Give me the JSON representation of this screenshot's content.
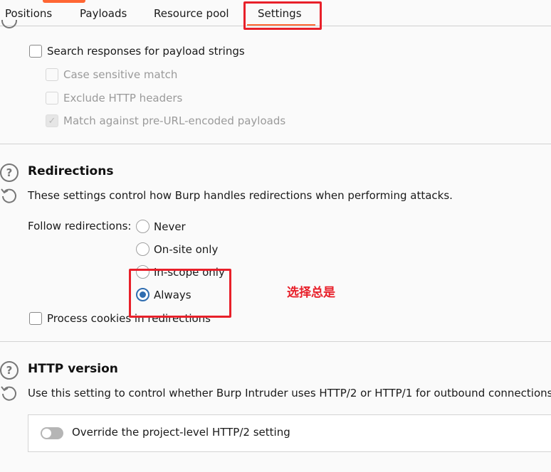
{
  "tabs": [
    {
      "label": "Positions",
      "active": false
    },
    {
      "label": "Payloads",
      "active": false
    },
    {
      "label": "Resource pool",
      "active": false
    },
    {
      "label": "Settings",
      "active": true
    }
  ],
  "grep_payloads": {
    "search_responses": {
      "label": "Search responses for payload strings",
      "checked": false
    },
    "case_sensitive": {
      "label": "Case sensitive match",
      "checked": false,
      "disabled": true
    },
    "exclude_headers": {
      "label": "Exclude HTTP headers",
      "checked": false,
      "disabled": true
    },
    "match_pre_encoded": {
      "label": "Match against pre-URL-encoded payloads",
      "checked": true,
      "disabled": true
    }
  },
  "redirections": {
    "title": "Redirections",
    "description": "These settings control how Burp handles redirections when performing attacks.",
    "follow_label": "Follow redirections:",
    "options": [
      {
        "label": "Never",
        "selected": false
      },
      {
        "label": "On-site only",
        "selected": false
      },
      {
        "label": "In-scope only",
        "selected": false
      },
      {
        "label": "Always",
        "selected": true
      }
    ],
    "process_cookies": {
      "label": "Process cookies in redirections",
      "checked": false
    }
  },
  "annotation": {
    "text": "选择总是",
    "color": "#e8202a"
  },
  "http_version": {
    "title": "HTTP version",
    "description": "Use this setting to control whether Burp Intruder uses HTTP/2 or HTTP/1 for outbound connections o",
    "override_toggle": {
      "label": "Override the project-level HTTP/2 setting",
      "on": false
    }
  },
  "colors": {
    "accent": "#ff6633",
    "selection": "#2f6db0",
    "annotation_red": "#e8202a"
  }
}
